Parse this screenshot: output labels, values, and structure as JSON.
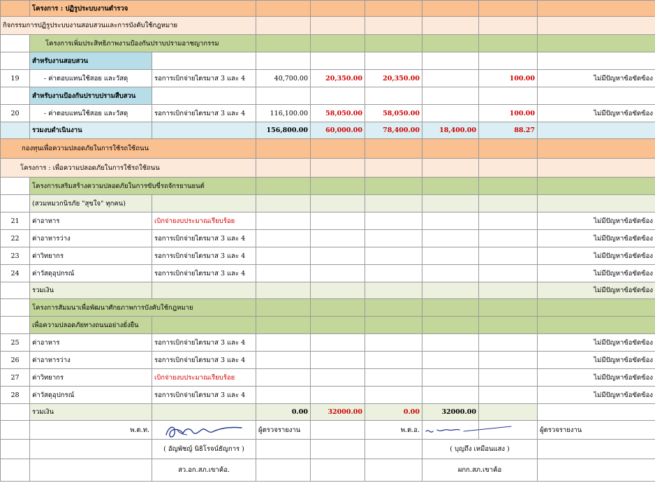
{
  "project_header": "โครงการ : ปฏิรูประบบงานตำรวจ",
  "activity_reform": "กิจกรรมการปฏิรูประบบงานสอบสวนและการบังคับใช้กฎหมาย",
  "project_efficiency": "โครงการเพิ่มประสิทธิภาพงานป้องกันปราบปรามอาชญากรรม",
  "section_investigation": "สำหรับงานสอบสวน",
  "section_prevention": "สำหรับงานป้องกันปราบปรามสืบสวน",
  "rows_part1": [
    {
      "no": "19",
      "item": " - ค่าตอบแทนใช้สอย และวัสดุ",
      "status": "รอการเบิกจ่ายไตรมาส 3 และ 4",
      "budget": "40,700.00",
      "allocated": "20,350.00",
      "spent": "20,350.00",
      "remaining": "",
      "percent": "100.00",
      "problem": "ไม่มีปัญหาข้อขัดข้อง"
    },
    {
      "no": "20",
      "item": " - ค่าตอบแทนใช้สอย และวัสดุ",
      "status": "รอการเบิกจ่ายไตรมาส 3 และ 4",
      "budget": "116,100.00",
      "allocated": "58,050.00",
      "spent": "58,050.00",
      "remaining": "",
      "percent": "100.00",
      "problem": "ไม่มีปัญหาข้อขัดข้อง"
    }
  ],
  "total_operations": {
    "label": "รวมงบดำเนินงาน",
    "budget": "156,800.00",
    "allocated": "60,000.00",
    "spent": "78,400.00",
    "remaining": "18,400.00",
    "percent": "88.27"
  },
  "fund_safety": "กองทุนเพื่อความปลอดภัยในการใช้รถใช้ถนน",
  "project_safety": "โครงการ : เพื่อความปลอดภัยในการใช้รถใช้ถนน",
  "project_motorcycle": "โครงการเสริมสร้างความปลอดภัยในการขับขี่รถจักรยานยนต์",
  "campaign": "(สวมหมวกนิรภัย \"สุขใจ\" ทุกคน)",
  "rows_part2": [
    {
      "no": "21",
      "item": "ค่าอาหาร",
      "status": "เบิกจ่ายงบประมาณเรียบร้อย",
      "status_red": true,
      "problem": "ไม่มีปัญหาข้อขัดข้อง"
    },
    {
      "no": "22",
      "item": "ค่าอาหารว่าง",
      "status": "รอการเบิกจ่ายไตรมาส 3 และ 4",
      "status_red": false,
      "problem": "ไม่มีปัญหาข้อขัดข้อง"
    },
    {
      "no": "23",
      "item": "ค่าวิทยากร",
      "status": "รอการเบิกจ่ายไตรมาส 3 และ 4",
      "status_red": false,
      "problem": "ไม่มีปัญหาข้อขัดข้อง"
    },
    {
      "no": "24",
      "item": "ค่าวัสดุอุปกรณ์",
      "status": "รอการเบิกจ่ายไตรมาส 3 และ 4",
      "status_red": false,
      "problem": "ไม่มีปัญหาข้อขัดข้อง"
    }
  ],
  "subtotal1": {
    "label": "รวมเงิน",
    "problem": "ไม่มีปัญหาข้อขัดข้อง"
  },
  "project_seminar": "โครงการสัมมนาเพื่อพัฒนาศักยภาพการบังคับใช้กฎหมาย",
  "project_sustainable": "เพื่อความปลอดภัยทางถนนอย่างยั่งยืน",
  "rows_part3": [
    {
      "no": "25",
      "item": "ค่าอาหาร",
      "status": "รอการเบิกจ่ายไตรมาส 3 และ 4",
      "status_red": false,
      "problem": "ไม่มีปัญหาข้อขัดข้อง"
    },
    {
      "no": "26",
      "item": "ค่าอาหารว่าง",
      "status": "รอการเบิกจ่ายไตรมาส 3 และ 4",
      "status_red": false,
      "problem": "ไม่มีปัญหาข้อขัดข้อง"
    },
    {
      "no": "27",
      "item": "ค่าวิทยากร",
      "status": "เบิกจ่ายงบประมาณเรียบร้อย",
      "status_red": true,
      "problem": "ไม่มีปัญหาข้อขัดข้อง"
    },
    {
      "no": "28",
      "item": "ค่าวัสดุอุปกรณ์",
      "status": "รอการเบิกจ่ายไตรมาส 3 และ 4",
      "status_red": false,
      "problem": "ไม่มีปัญหาข้อขัดข้อง"
    }
  ],
  "subtotal2": {
    "label": "รวมเงิน",
    "budget": "0.00",
    "allocated": "32000.00",
    "spent": "0.00",
    "remaining": "32000.00"
  },
  "signatures": {
    "left_rank": "พ.ต.ท.",
    "left_name": "( อัญพัชญ์  นิธิโรจน์ธัญการ )",
    "left_position": "สว.อก.สภ.เขาค้อ.",
    "left_role": "ผู้ตรวจรายงาน",
    "right_rank": "พ.ต.อ.",
    "right_name": "( บุญถึง   เหมือนแสง )",
    "right_position": "ผกก.สภ.เขาค้อ",
    "right_role": "ผู้ตรวจรายงาน"
  },
  "colors": {
    "orange": "#fac090",
    "peach": "#fde9d9",
    "green": "#c4d79b",
    "blue": "#b7dee8",
    "light_blue": "#daeef3",
    "light_green": "#ebf1de",
    "red_text": "#d00000"
  }
}
